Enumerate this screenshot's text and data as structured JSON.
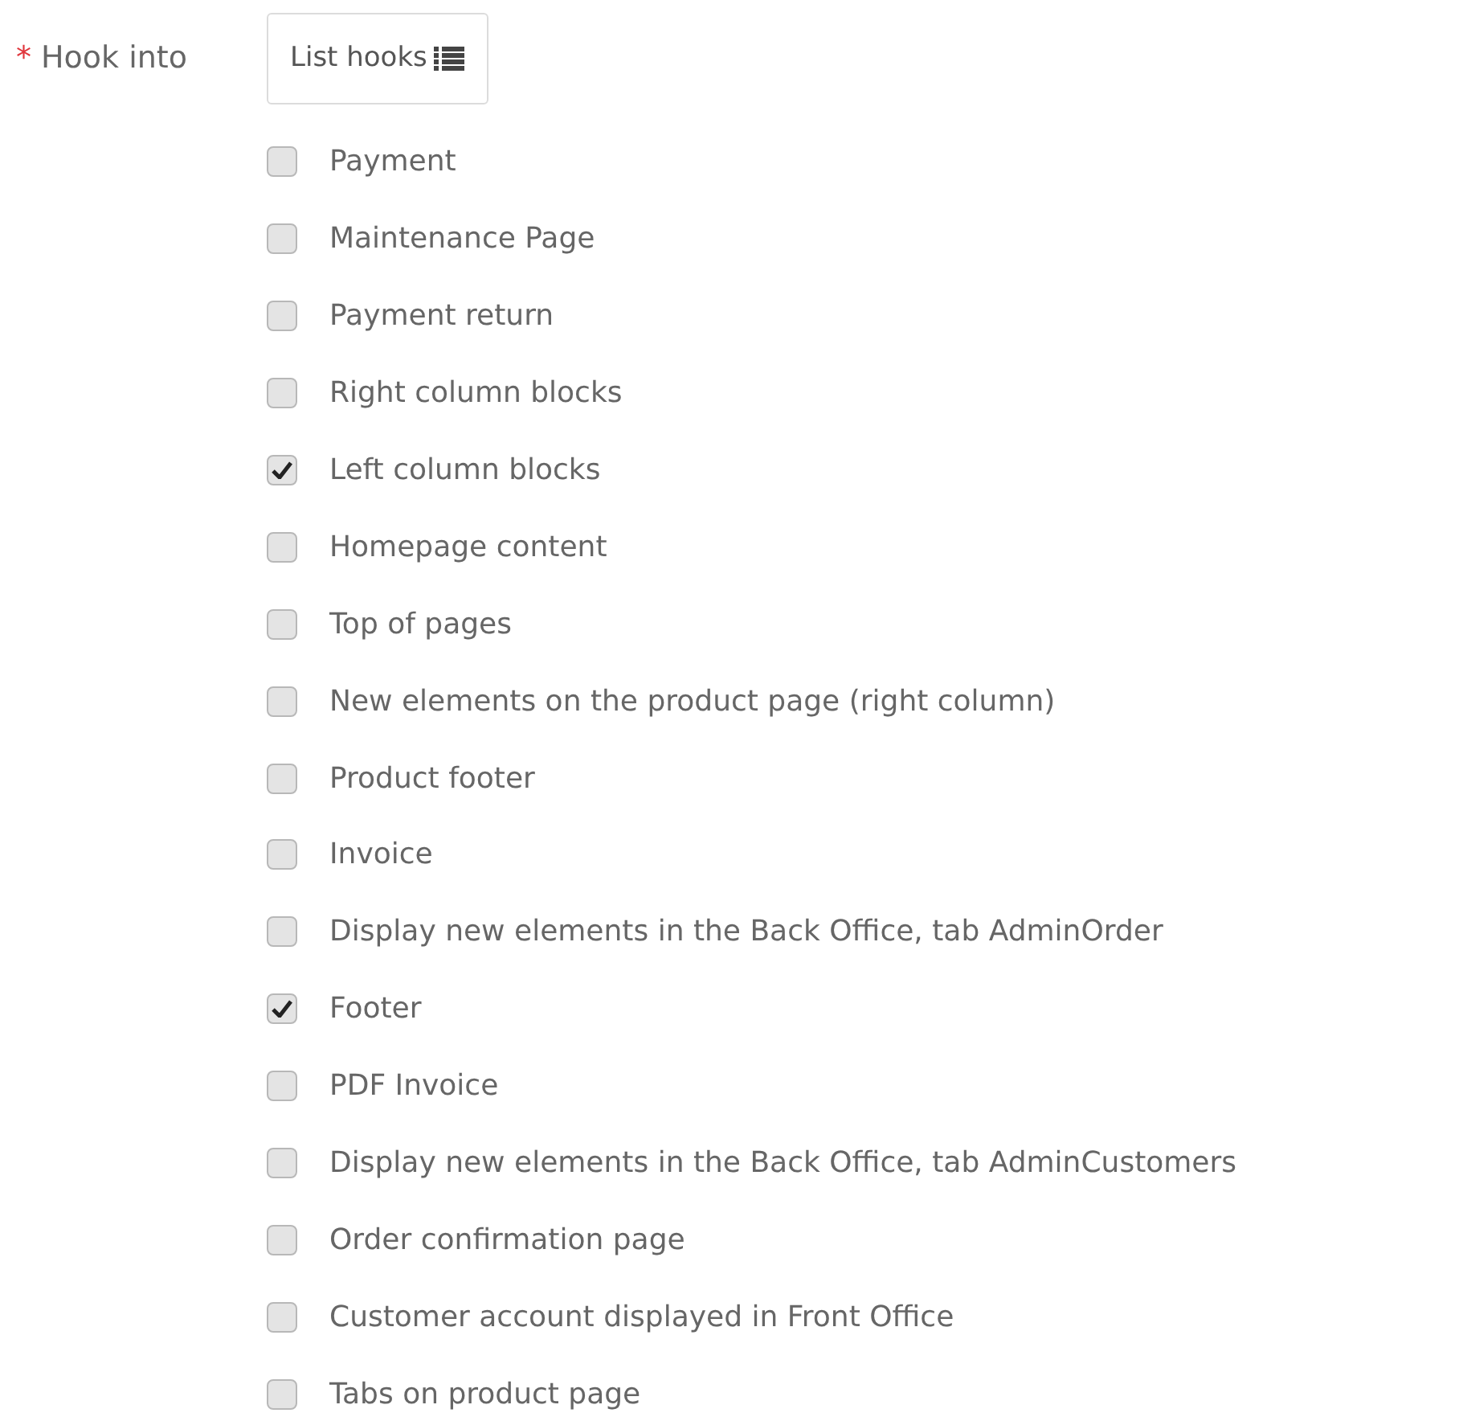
{
  "field": {
    "required_mark": "*",
    "label": "Hook into",
    "button": {
      "label": "List hooks"
    }
  },
  "hooks": [
    {
      "label": "Payment",
      "checked": false
    },
    {
      "label": "Maintenance Page",
      "checked": false
    },
    {
      "label": "Payment return",
      "checked": false
    },
    {
      "label": "Right column blocks",
      "checked": false
    },
    {
      "label": "Left column blocks",
      "checked": true
    },
    {
      "label": "Homepage content",
      "checked": false
    },
    {
      "label": "Top of pages",
      "checked": false
    },
    {
      "label": "New elements on the product page (right column)",
      "checked": false
    },
    {
      "label": "Product footer",
      "checked": false
    },
    {
      "label": "Invoice",
      "checked": false
    },
    {
      "label": "Display new elements in the Back Office, tab AdminOrder",
      "checked": false
    },
    {
      "label": "Footer",
      "checked": true
    },
    {
      "label": "PDF Invoice",
      "checked": false
    },
    {
      "label": "Display new elements in the Back Office, tab AdminCustomers",
      "checked": false
    },
    {
      "label": "Order confirmation page",
      "checked": false
    },
    {
      "label": "Customer account displayed in Front Office",
      "checked": false
    },
    {
      "label": "Tabs on product page",
      "checked": false
    }
  ]
}
